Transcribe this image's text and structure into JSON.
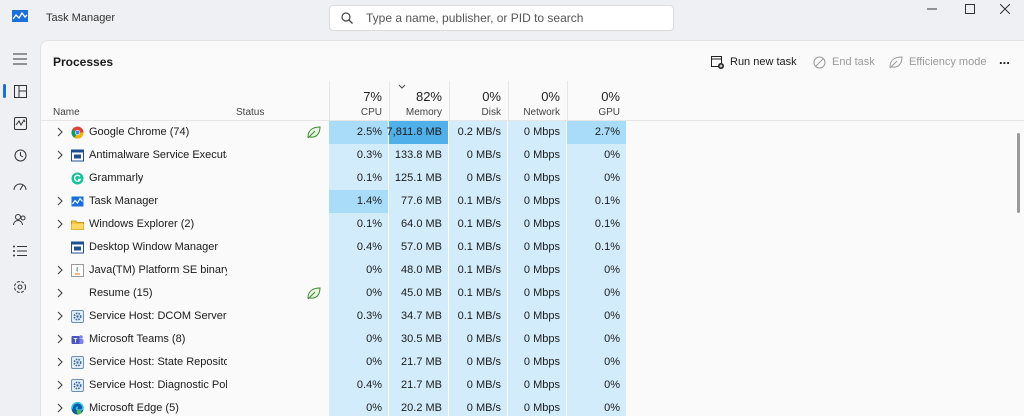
{
  "app": {
    "title": "Task Manager"
  },
  "search": {
    "placeholder": "Type a name, publisher, or PID to search"
  },
  "toolbar": {
    "page_title": "Processes",
    "run_new_task": "Run new task",
    "end_task": "End task",
    "efficiency_mode": "Efficiency mode",
    "more": "..."
  },
  "columns": {
    "name": "Name",
    "status": "Status",
    "cpu": {
      "pct": "7%",
      "label": "CPU"
    },
    "memory": {
      "pct": "82%",
      "label": "Memory"
    },
    "disk": {
      "pct": "0%",
      "label": "Disk"
    },
    "network": {
      "pct": "0%",
      "label": "Network"
    },
    "gpu": {
      "pct": "0%",
      "label": "GPU"
    }
  },
  "nav": [
    "menu-icon",
    "processes-icon",
    "performance-icon",
    "app-history-icon",
    "startup-apps-icon",
    "users-icon",
    "details-icon",
    "services-icon"
  ],
  "processes": [
    {
      "name": "Google Chrome (74)",
      "expandable": true,
      "icon": "chrome",
      "eco": true,
      "cpu": "2.5%",
      "memory": "7,811.8 MB",
      "disk": "0.2 MB/s",
      "network": "0 Mbps",
      "gpu": "2.7%"
    },
    {
      "name": "Antimalware Service Executable",
      "expandable": true,
      "icon": "window",
      "eco": false,
      "cpu": "0.3%",
      "memory": "133.8 MB",
      "disk": "0 MB/s",
      "network": "0 Mbps",
      "gpu": "0%"
    },
    {
      "name": "Grammarly",
      "expandable": false,
      "icon": "grammarly",
      "eco": false,
      "cpu": "0.1%",
      "memory": "125.1 MB",
      "disk": "0 MB/s",
      "network": "0 Mbps",
      "gpu": "0%"
    },
    {
      "name": "Task Manager",
      "expandable": true,
      "icon": "taskmgr",
      "eco": false,
      "cpu": "1.4%",
      "memory": "77.6 MB",
      "disk": "0.1 MB/s",
      "network": "0 Mbps",
      "gpu": "0.1%"
    },
    {
      "name": "Windows Explorer (2)",
      "expandable": true,
      "icon": "folder",
      "eco": false,
      "cpu": "0.1%",
      "memory": "64.0 MB",
      "disk": "0.1 MB/s",
      "network": "0 Mbps",
      "gpu": "0.1%"
    },
    {
      "name": "Desktop Window Manager",
      "expandable": false,
      "icon": "window",
      "eco": false,
      "cpu": "0.4%",
      "memory": "57.0 MB",
      "disk": "0.1 MB/s",
      "network": "0 Mbps",
      "gpu": "0.1%"
    },
    {
      "name": "Java(TM) Platform SE binary",
      "expandable": true,
      "icon": "java",
      "eco": false,
      "cpu": "0%",
      "memory": "48.0 MB",
      "disk": "0.1 MB/s",
      "network": "0 Mbps",
      "gpu": "0%"
    },
    {
      "name": "Resume (15)",
      "expandable": true,
      "icon": "none",
      "eco": true,
      "cpu": "0%",
      "memory": "45.0 MB",
      "disk": "0.1 MB/s",
      "network": "0 Mbps",
      "gpu": "0%"
    },
    {
      "name": "Service Host: DCOM Server Pr...",
      "expandable": true,
      "icon": "gear",
      "eco": false,
      "cpu": "0.3%",
      "memory": "34.7 MB",
      "disk": "0.1 MB/s",
      "network": "0 Mbps",
      "gpu": "0%"
    },
    {
      "name": "Microsoft Teams (8)",
      "expandable": true,
      "icon": "teams",
      "eco": false,
      "cpu": "0%",
      "memory": "30.5 MB",
      "disk": "0 MB/s",
      "network": "0 Mbps",
      "gpu": "0%"
    },
    {
      "name": "Service Host: State Repository ...",
      "expandable": true,
      "icon": "gear",
      "eco": false,
      "cpu": "0%",
      "memory": "21.7 MB",
      "disk": "0 MB/s",
      "network": "0 Mbps",
      "gpu": "0%"
    },
    {
      "name": "Service Host: Diagnostic Polic...",
      "expandable": true,
      "icon": "gear",
      "eco": false,
      "cpu": "0.4%",
      "memory": "21.7 MB",
      "disk": "0 MB/s",
      "network": "0 Mbps",
      "gpu": "0%"
    },
    {
      "name": "Microsoft Edge (5)",
      "expandable": true,
      "icon": "edge",
      "eco": false,
      "cpu": "0%",
      "memory": "20.2 MB",
      "disk": "0 MB/s",
      "network": "0 Mbps",
      "gpu": "0%"
    }
  ],
  "colors": {
    "accent": "#1b6fd8",
    "heat_low": "#d3ecfb",
    "heat_mid": "#a9dcf8",
    "heat_high": "#4fb0ea"
  }
}
